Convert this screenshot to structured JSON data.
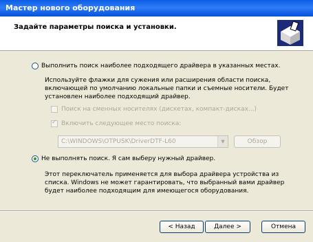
{
  "window": {
    "title": "Мастер нового оборудования"
  },
  "header": {
    "title": "Задайте параметры поиска и установки.",
    "icon": "hardware-box-icon"
  },
  "option_search": {
    "label": "Выполнить поиск наиболее подходящего драйвера в указанных местах.",
    "description": "Используйте флажки для сужения или расширения области поиска, включающей по умолчанию локальные папки и съемные носители. Будет установлен наиболее подходящий драйвер.",
    "selected": false
  },
  "check_removable": {
    "label": "Поиск на сменных носителях (дискетах, компакт-дисках...)",
    "checked": false
  },
  "check_include": {
    "label": "Включить следующее место поиска:",
    "checked": true
  },
  "path_combo": {
    "value": "C:\\WINDOWS\\OTPUSK\\DriverDTF-L60"
  },
  "browse_button": {
    "label": "Обзор"
  },
  "option_manual": {
    "label": "Не выполнять поиск. Я сам выберу нужный драйвер.",
    "description": "Этот переключатель применяется для выбора драйвера устройства из списка. Windows не может гарантировать, что выбранный вами драйвер будет наиболее подходящим для имеющегося оборудования.",
    "selected": true
  },
  "buttons": {
    "back": "< Назад",
    "next": "Далее >",
    "cancel": "Отмена"
  }
}
